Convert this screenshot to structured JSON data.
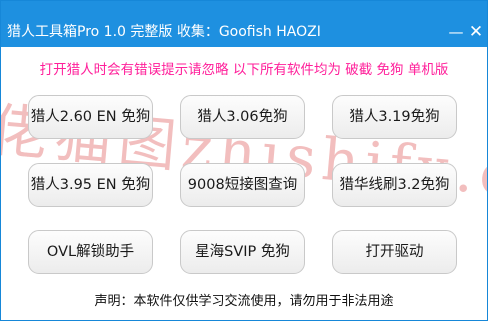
{
  "window": {
    "title": "猎人工具箱Pro  1.0 完整版  收集：Goofish HAOZI",
    "min_label": "—",
    "close_label": "✕"
  },
  "notice": "打开猎人时会有错误提示请忽略 以下所有软件均为 破截 免狗 单机版",
  "watermark": "佬猫图zhishifx.com",
  "buttons": [
    {
      "label": "猎人2.60 EN 免狗"
    },
    {
      "label": "猎人3.06免狗"
    },
    {
      "label": "猎人3.19免狗"
    },
    {
      "label": "猎人3.95 EN 免狗"
    },
    {
      "label": "9008短接图查询"
    },
    {
      "label": "猎华线刷3.2免狗"
    },
    {
      "label": "OVL解锁助手"
    },
    {
      "label": "星海SVIP 免狗"
    },
    {
      "label": "打开驱动"
    }
  ],
  "footer": "声明：本软件仅供学习交流使用，请勿用于非法用途",
  "colors": {
    "titlebar": "#1e90e0",
    "notice_text": "#ff1f9a",
    "watermark": "#e98a8a"
  }
}
